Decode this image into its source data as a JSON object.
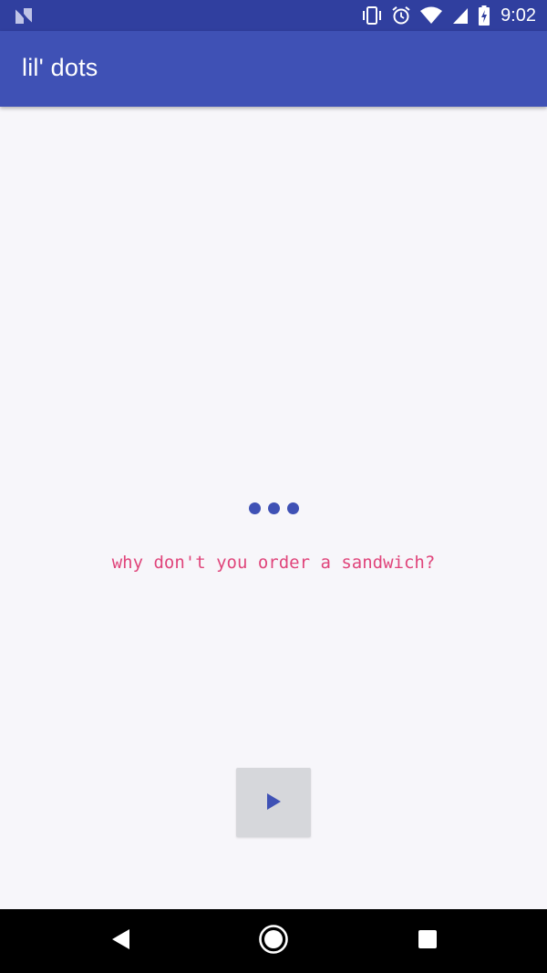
{
  "status_bar": {
    "time": "9:02",
    "left_icon": "n-logo-icon",
    "icons": [
      "vibrate-icon",
      "alarm-icon",
      "wifi-icon",
      "signal-icon",
      "battery-charging-icon"
    ]
  },
  "app_bar": {
    "title": "lil' dots"
  },
  "main": {
    "indicator": "typing-dots",
    "message": "why don't you order a sandwich?",
    "play_button_icon": "play-icon"
  },
  "nav_bar": {
    "icons": [
      "back-icon",
      "home-icon",
      "recents-icon"
    ]
  },
  "colors": {
    "status_bar": "#303f9f",
    "app_bar": "#3f51b5",
    "accent_text": "#e0457b",
    "dots": "#3f51b5",
    "background": "#f7f6fa",
    "button": "#d6d7db"
  }
}
